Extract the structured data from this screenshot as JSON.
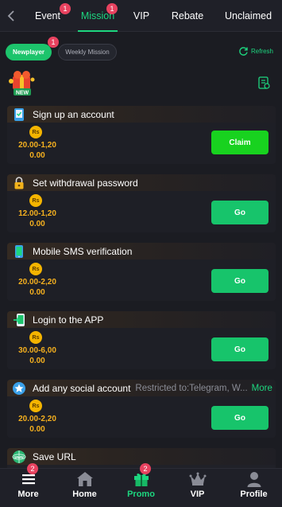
{
  "tabs": [
    {
      "label": "Event",
      "badge": "1"
    },
    {
      "label": "Mission",
      "badge": "1"
    },
    {
      "label": "VIP",
      "badge": ""
    },
    {
      "label": "Rebate",
      "badge": ""
    },
    {
      "label": "Unclaimed",
      "badge": ""
    }
  ],
  "active_tab": "Mission",
  "subtabs": {
    "newplayer": "Newplayer",
    "newplayer_badge": "1",
    "weekly": "Weekly Mission",
    "refresh": "Refresh"
  },
  "currency_symbol": "Rs",
  "missions": [
    {
      "title": "Sign up an account",
      "range": "20.00-1,20",
      "amount": "0.00",
      "button": "Claim",
      "icon": "mobile-check-icon"
    },
    {
      "title": "Set withdrawal password",
      "range": "12.00-1,20",
      "amount": "0.00",
      "button": "Go",
      "icon": "lock-icon"
    },
    {
      "title": "Mobile SMS verification",
      "range": "20.00-2,20",
      "amount": "0.00",
      "button": "Go",
      "icon": "sms-phone-icon"
    },
    {
      "title": "Login to the APP",
      "range": "30.00-6,00",
      "amount": "0.00",
      "button": "Go",
      "icon": "app-login-icon"
    },
    {
      "title": "Add any social account",
      "restricted": "Restricted to:Telegram, W...",
      "more": "More",
      "range": "20.00-2,20",
      "amount": "0.00",
      "button": "Go",
      "icon": "social-star-icon"
    },
    {
      "title": "Save URL",
      "icon": "www-globe-icon"
    }
  ],
  "bottom_nav": [
    {
      "label": "More",
      "badge": "2",
      "icon": "menu-icon"
    },
    {
      "label": "Home",
      "badge": "",
      "icon": "home-icon"
    },
    {
      "label": "Promo",
      "badge": "2",
      "icon": "gift-icon"
    },
    {
      "label": "VIP",
      "badge": "",
      "icon": "crown-icon"
    },
    {
      "label": "Profile",
      "badge": "",
      "icon": "user-icon"
    }
  ],
  "colors": {
    "accent_green": "#1dd67f",
    "claim_green": "#18d21f",
    "go_green": "#17c46b",
    "badge_red": "#e8425f",
    "amount_gold": "#f5b01f",
    "background": "#1b1c22"
  }
}
